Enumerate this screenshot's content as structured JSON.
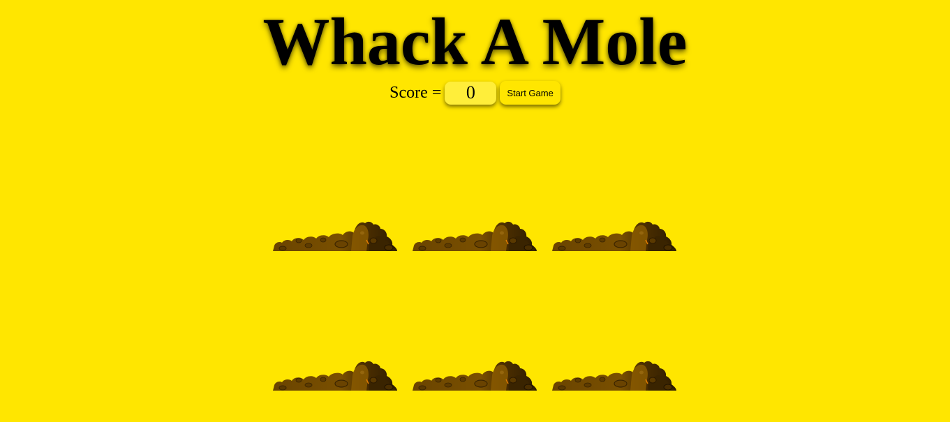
{
  "title": "Whack A Mole",
  "score": {
    "label": "Score =",
    "value": "0"
  },
  "start_button": {
    "label": "Start Game"
  },
  "holes": [
    {
      "row": 1,
      "col": 1,
      "icon": "dirt-mound-icon"
    },
    {
      "row": 1,
      "col": 2,
      "icon": "dirt-mound-icon"
    },
    {
      "row": 1,
      "col": 3,
      "icon": "dirt-mound-icon"
    },
    {
      "row": 2,
      "col": 1,
      "icon": "dirt-mound-icon"
    },
    {
      "row": 2,
      "col": 2,
      "icon": "dirt-mound-icon"
    },
    {
      "row": 2,
      "col": 3,
      "icon": "dirt-mound-icon"
    }
  ],
  "colors": {
    "background": "#ffe600",
    "score_box": "#ffee3a",
    "dirt_light": "#8a5a00",
    "dirt_mid": "#6e4700",
    "dirt_dark": "#3e2600"
  }
}
